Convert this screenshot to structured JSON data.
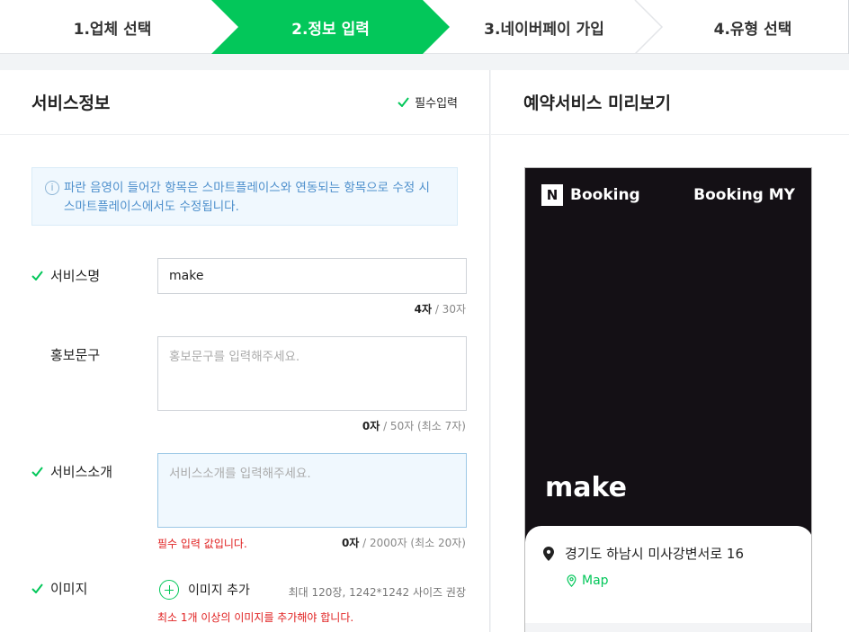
{
  "steps": [
    {
      "label": "1.업체 선택"
    },
    {
      "label": "2.정보 입력"
    },
    {
      "label": "3.네이버페이 가입"
    },
    {
      "label": "4.유형 선택"
    }
  ],
  "form": {
    "title": "서비스정보",
    "required_label": "필수입력",
    "notice": "파란 음영이 들어간 항목은 스마트플레이스와 연동되는 항목으로 수정 시 스마트플레이스에서도 수정됩니다.",
    "service_name": {
      "label": "서비스명",
      "value": "make",
      "count": "4자",
      "max": "/ 30자"
    },
    "promo": {
      "label": "홍보문구",
      "placeholder": "홍보문구를 입력해주세요.",
      "count": "0자",
      "max": "/ 50자 (최소 7자)"
    },
    "intro": {
      "label": "서비스소개",
      "placeholder": "서비스소개를 입력해주세요.",
      "error": "필수 입력 값입니다.",
      "count": "0자",
      "max": "/ 2000자 (최소 20자)"
    },
    "image": {
      "label": "이미지",
      "add_label": "이미지 추가",
      "hint": "최대 120장, 1242*1242 사이즈 권장",
      "error": "최소 1개 이상의 이미지를 추가해야 합니다."
    }
  },
  "preview": {
    "title": "예약서비스 미리보기",
    "logo_mark": "N",
    "logo_text": "Booking",
    "my_link": "Booking MY",
    "service_name": "make",
    "address": "경기도 하남시 미사강변서로 16",
    "map_link": "Map"
  },
  "colors": {
    "accent": "#03c75a",
    "error": "#e02020",
    "notice_text": "#4d8fcc"
  }
}
